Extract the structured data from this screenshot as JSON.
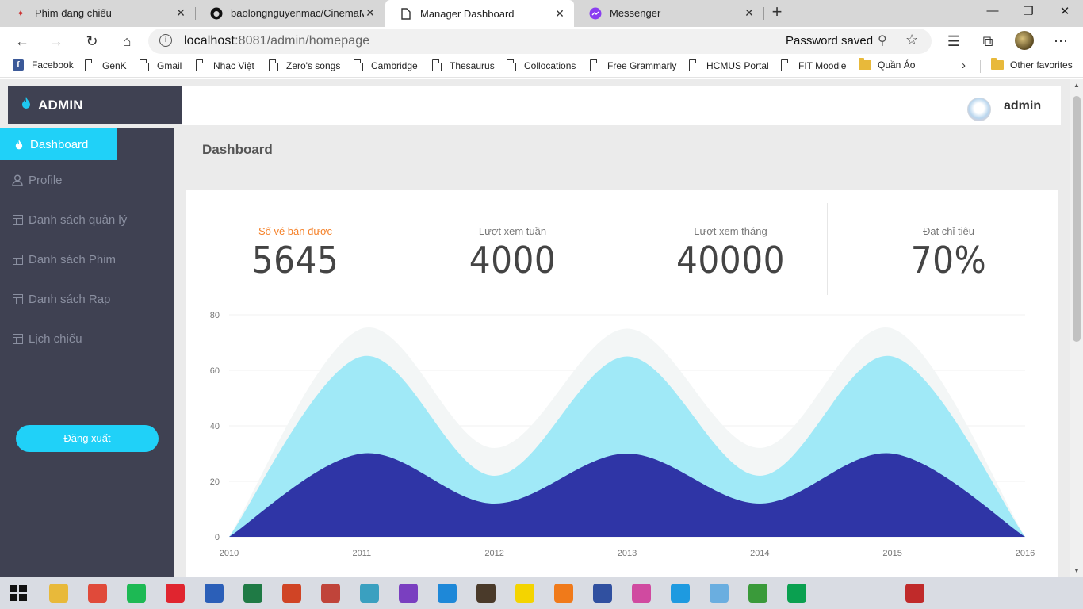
{
  "browser": {
    "tabs": [
      {
        "label": "Phim đang chiếu",
        "icon": "movie-app-icon"
      },
      {
        "label": "baolongnguyenmac/CinemaMan",
        "icon": "github-icon"
      },
      {
        "label": "Manager Dashboard",
        "icon": "page-icon"
      },
      {
        "label": "Messenger",
        "icon": "messenger-icon"
      }
    ],
    "address": {
      "host": "localhost",
      "path": ":8081/admin/homepage",
      "password_saved": "Password saved"
    },
    "bookmarks": [
      {
        "label": "Facebook",
        "icon": "facebook-icon"
      },
      {
        "label": "GenK",
        "icon": "page-icon"
      },
      {
        "label": "Gmail",
        "icon": "page-icon"
      },
      {
        "label": "Nhạc Việt",
        "icon": "page-icon"
      },
      {
        "label": "Zero's songs",
        "icon": "page-icon"
      },
      {
        "label": "Cambridge",
        "icon": "page-icon"
      },
      {
        "label": "Thesaurus",
        "icon": "page-icon"
      },
      {
        "label": "Collocations",
        "icon": "page-icon"
      },
      {
        "label": "Free Grammarly",
        "icon": "page-icon"
      },
      {
        "label": "HCMUS Portal",
        "icon": "page-icon"
      },
      {
        "label": "FIT Moodle",
        "icon": "page-icon"
      },
      {
        "label": "Quần Áo",
        "icon": "folder-icon"
      }
    ],
    "other_favorites": "Other favorites"
  },
  "app": {
    "brand": "ADMIN",
    "user": "admin",
    "page_title": "Dashboard",
    "accent": "#20d1f8",
    "sidebar_bg": "#3f4152",
    "nav": [
      {
        "label": "Dashboard",
        "icon": "flame-icon",
        "active": true
      },
      {
        "label": "Profile",
        "icon": "user-icon",
        "active": false
      },
      {
        "label": "Danh sách quản lý",
        "icon": "table-icon",
        "active": false
      },
      {
        "label": "Danh sách Phim",
        "icon": "table-icon",
        "active": false
      },
      {
        "label": "Danh sách Rạp",
        "icon": "table-icon",
        "active": false
      },
      {
        "label": "Lịch chiếu",
        "icon": "table-icon",
        "active": false
      }
    ],
    "logout": "Đăng xuất",
    "stats": [
      {
        "label": "Số vé bán được",
        "value": "5645"
      },
      {
        "label": "Lượt xem tuần",
        "value": "4000"
      },
      {
        "label": "Lượt xem tháng",
        "value": "40000"
      },
      {
        "label": "Đạt chỉ tiêu",
        "value": "70%"
      }
    ]
  },
  "chart_data": {
    "type": "area",
    "x": [
      2010,
      2011,
      2012,
      2013,
      2014,
      2015,
      2016
    ],
    "ylim": [
      0,
      80
    ],
    "yticks": [
      0,
      20,
      40,
      60,
      80
    ],
    "grid": true,
    "stacked": true,
    "series": [
      {
        "values": [
          0,
          30,
          12,
          30,
          12,
          30,
          0
        ],
        "color": "#2f35a6"
      },
      {
        "values": [
          0,
          35,
          10,
          35,
          10,
          35,
          0
        ],
        "color": "#a0e9f7"
      },
      {
        "values": [
          0,
          10,
          10,
          10,
          10,
          10,
          0
        ],
        "color": "#f3f6f6"
      }
    ]
  },
  "taskbar": {
    "apps": [
      "file-explorer-icon",
      "chrome-icon",
      "spotify-icon",
      "opera-icon",
      "word-icon",
      "excel-icon",
      "powerpoint-icon",
      "app-icon",
      "app-icon",
      "visual-studio-icon",
      "vscode-icon",
      "app-icon",
      "sticky-notes-icon",
      "app-icon",
      "app-icon",
      "app-icon",
      "edge-icon",
      "paint-icon",
      "app-icon",
      "app-icon",
      "app-icon"
    ]
  }
}
